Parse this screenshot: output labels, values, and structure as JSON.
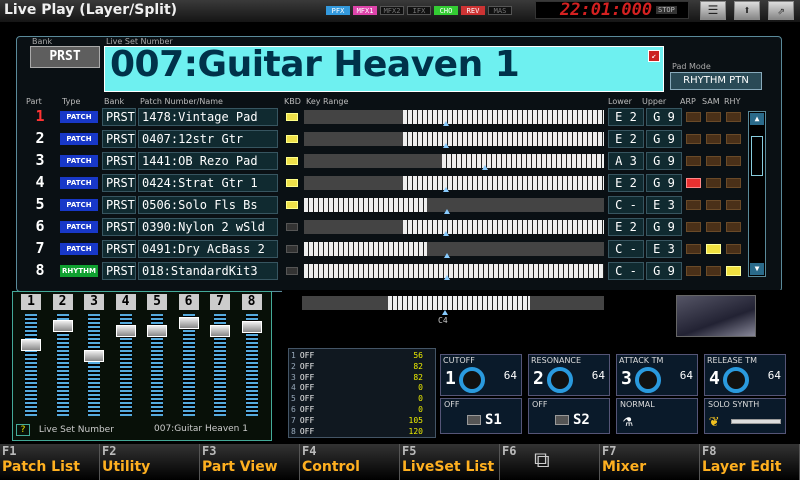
{
  "window": {
    "title": "Live Play (Layer/Split)"
  },
  "fx": [
    "PFX",
    "MFX1",
    "MFX2",
    "IFX",
    "CHO",
    "REV",
    "MAS"
  ],
  "fx_colors": [
    "#39d",
    "#d4a",
    "#666",
    "#666",
    "#3c3",
    "#c33",
    "#666"
  ],
  "clock": {
    "time": "22:01:000",
    "stop": "STOP"
  },
  "header": {
    "bank_label": "Bank",
    "bank_value": "PRST",
    "live_set_label": "Live Set Number",
    "live_set_name": "007:Guitar Heaven 1",
    "pad_mode_label": "Pad Mode",
    "pad_mode_value": "RHYTHM PTN"
  },
  "columns": {
    "part": "Part",
    "type": "Type",
    "bank": "Bank",
    "patch": "Patch Number/Name",
    "kbd": "KBD",
    "range": "Key Range",
    "lower": "Lower",
    "upper": "Upper",
    "arp": "ARP",
    "sam": "SAM",
    "rhy": "RHY"
  },
  "parts": [
    {
      "num": "1",
      "type": "PATCH",
      "bank": "PRST",
      "patch": "1478:Vintage Pad",
      "kbd": true,
      "lower": "E 2",
      "upper": "G 9",
      "arp": false,
      "sam": false,
      "rhy": false
    },
    {
      "num": "2",
      "type": "PATCH",
      "bank": "PRST",
      "patch": "0407:12str Gtr",
      "kbd": true,
      "lower": "E 2",
      "upper": "G 9",
      "arp": false,
      "sam": false,
      "rhy": false
    },
    {
      "num": "3",
      "type": "PATCH",
      "bank": "PRST",
      "patch": "1441:OB Rezo Pad",
      "kbd": true,
      "lower": "A 3",
      "upper": "G 9",
      "arp": false,
      "sam": false,
      "rhy": false
    },
    {
      "num": "4",
      "type": "PATCH",
      "bank": "PRST",
      "patch": "0424:Strat Gtr 1",
      "kbd": true,
      "lower": "E 2",
      "upper": "G 9",
      "arp": true,
      "sam": false,
      "rhy": false
    },
    {
      "num": "5",
      "type": "PATCH",
      "bank": "PRST",
      "patch": "0506:Solo Fls Bs",
      "kbd": true,
      "lower": "C -",
      "upper": "E 3",
      "arp": false,
      "sam": false,
      "rhy": false
    },
    {
      "num": "6",
      "type": "PATCH",
      "bank": "PRST",
      "patch": "0390:Nylon 2 wSld",
      "kbd": false,
      "lower": "E 2",
      "upper": "G 9",
      "arp": false,
      "sam": false,
      "rhy": false
    },
    {
      "num": "7",
      "type": "PATCH",
      "bank": "PRST",
      "patch": "0491:Dry AcBass 2",
      "kbd": false,
      "lower": "C -",
      "upper": "E 3",
      "arp": false,
      "sam": true,
      "rhy": false
    },
    {
      "num": "8",
      "type": "RHYTHM",
      "bank": "PRST",
      "patch": "018:StandardKit3",
      "kbd": false,
      "lower": "C -",
      "upper": "G 9",
      "arp": false,
      "sam": false,
      "rhy": true
    }
  ],
  "mixer": {
    "channels": [
      "1",
      "2",
      "3",
      "4",
      "5",
      "6",
      "7",
      "8"
    ],
    "levels": [
      0.72,
      0.93,
      0.6,
      0.88,
      0.88,
      0.97,
      0.88,
      0.92
    ]
  },
  "status_bar": {
    "help": "?",
    "label": "Live Set Number",
    "value": "007:Guitar Heaven 1"
  },
  "arp_display": {
    "note": "C4"
  },
  "sliders": [
    {
      "n": "1",
      "label": "OFF",
      "value": "56"
    },
    {
      "n": "2",
      "label": "OFF",
      "value": "82"
    },
    {
      "n": "3",
      "label": "OFF",
      "value": "82"
    },
    {
      "n": "4",
      "label": "OFF",
      "value": "0"
    },
    {
      "n": "5",
      "label": "OFF",
      "value": "0"
    },
    {
      "n": "6",
      "label": "OFF",
      "value": "0"
    },
    {
      "n": "7",
      "label": "OFF",
      "value": "105"
    },
    {
      "n": "8",
      "label": "OFF",
      "value": "120"
    }
  ],
  "knobs": [
    {
      "n": "1",
      "title": "CUTOFF",
      "value": "64"
    },
    {
      "n": "2",
      "title": "RESONANCE",
      "value": "64"
    },
    {
      "n": "3",
      "title": "ATTACK TM",
      "value": "64"
    },
    {
      "n": "4",
      "title": "RELEASE TM",
      "value": "64"
    }
  ],
  "switches": [
    {
      "title": "OFF",
      "label": "S1"
    },
    {
      "title": "OFF",
      "label": "S2"
    },
    {
      "title": "NORMAL",
      "label": ""
    },
    {
      "title": "SOLO SYNTH",
      "label": ""
    }
  ],
  "function_keys": [
    {
      "key": "F1",
      "label": "Patch List"
    },
    {
      "key": "F2",
      "label": "Utility"
    },
    {
      "key": "F3",
      "label": "Part View"
    },
    {
      "key": "F4",
      "label": "Control"
    },
    {
      "key": "F5",
      "label": "LiveSet List"
    },
    {
      "key": "F6",
      "label": ""
    },
    {
      "key": "F7",
      "label": "Mixer"
    },
    {
      "key": "F8",
      "label": "Layer Edit"
    }
  ]
}
